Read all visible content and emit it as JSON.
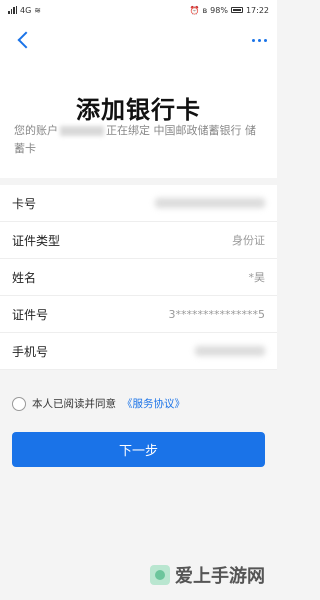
{
  "statusbar": {
    "battery": "98%",
    "time": "17:22",
    "signal_label": "4G"
  },
  "nav": {
    "back_icon": "chevron-left-icon",
    "more_icon": "more-dots-icon"
  },
  "header": {
    "title": "添加银行卡",
    "subtitle_prefix": "您的账户",
    "subtitle_suffix": "正在绑定 中国邮政储蓄银行 储蓄卡"
  },
  "form": {
    "rows": [
      {
        "label": "卡号",
        "value": ""
      },
      {
        "label": "证件类型",
        "value": "身份证"
      },
      {
        "label": "姓名",
        "value": "*昊"
      },
      {
        "label": "证件号",
        "value": "3***************5"
      },
      {
        "label": "手机号",
        "value": ""
      }
    ]
  },
  "agreement": {
    "text": "本人已阅读并同意",
    "link": "《服务协议》"
  },
  "next_button": "下一步",
  "watermark": {
    "text": "爱上手游网"
  },
  "colors": {
    "accent": "#1a73e8",
    "background": "#f4f4f4"
  }
}
